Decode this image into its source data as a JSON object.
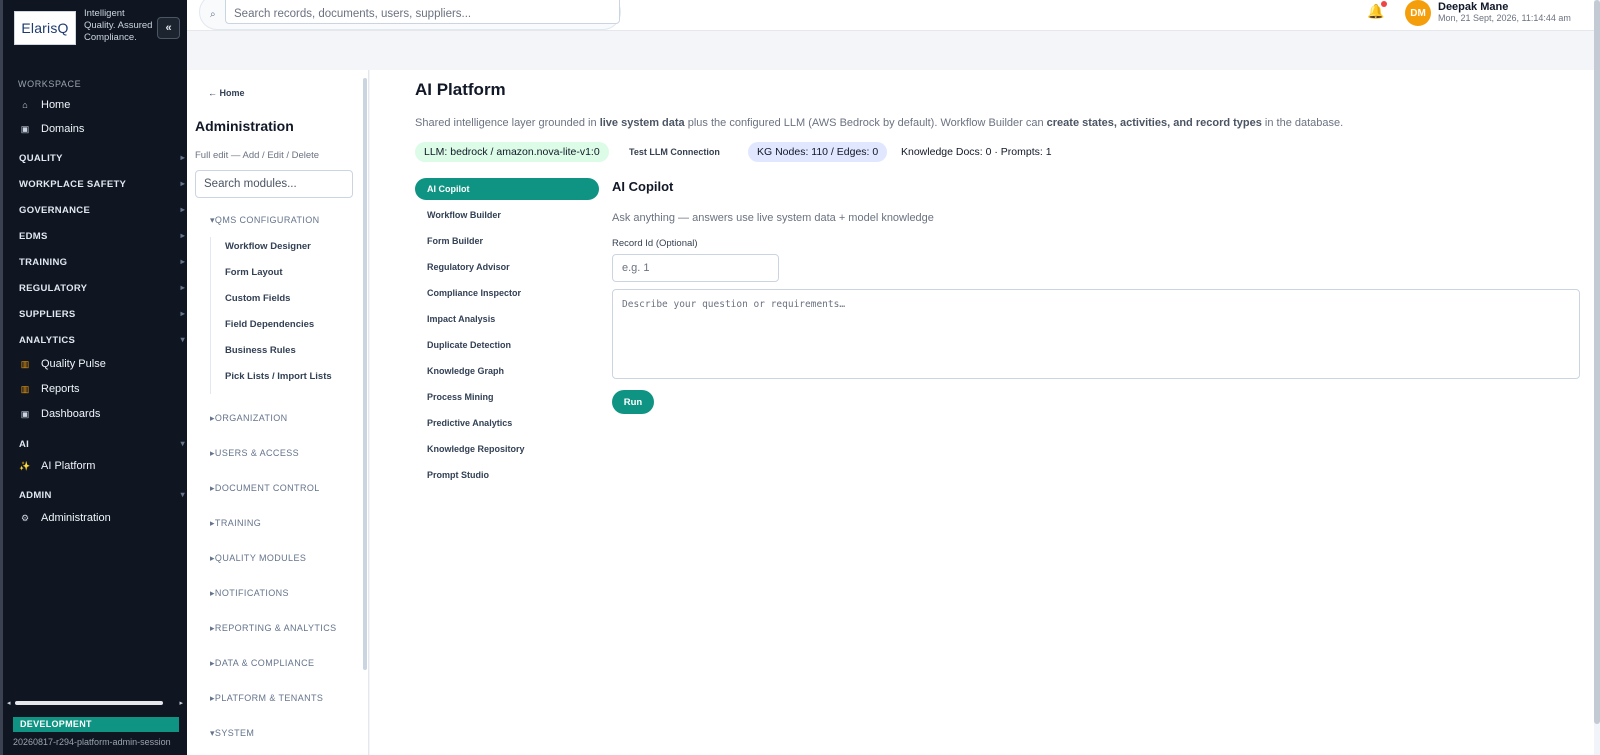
{
  "brand": {
    "logo_text": "ElarisQ",
    "tagline": "Intelligent Quality. Assured Compliance.",
    "collapse_label": "«"
  },
  "sidebar": {
    "workspace_heading": "WORKSPACE",
    "workspace_items": [
      {
        "label": "Home",
        "icon": "home-icon",
        "glyph": "⌂"
      },
      {
        "label": "Domains",
        "icon": "grid-icon",
        "glyph": "▣"
      }
    ],
    "groups": [
      "QUALITY",
      "WORKPLACE SAFETY",
      "GOVERNANCE",
      "EDMS",
      "TRAINING",
      "REGULATORY",
      "SUPPLIERS",
      "ANALYTICS"
    ],
    "analytics_items": [
      {
        "label": "Quality Pulse",
        "icon": "bar-chart-icon",
        "glyph": "▥"
      },
      {
        "label": "Reports",
        "icon": "bar-chart-icon",
        "glyph": "▥"
      },
      {
        "label": "Dashboards",
        "icon": "dashboard-icon",
        "glyph": "▣"
      }
    ],
    "ai_group": "AI",
    "ai_item": {
      "label": "AI Platform",
      "icon": "sparkle-icon",
      "glyph": "✨"
    },
    "admin_group": "ADMIN",
    "admin_item": {
      "label": "Administration",
      "icon": "gear-icon",
      "glyph": "⚙"
    },
    "environment": "DEVELOPMENT",
    "build": "20260817-r294-platform-admin-session"
  },
  "topbar": {
    "search_placeholder": "Search records, documents, users, suppliers...",
    "user_initials": "DM",
    "user_name": "Deepak Mane",
    "datetime": "Mon, 21 Sept, 2026, 11:14:44 am"
  },
  "admin": {
    "breadcrumb": "← Home",
    "title": "Administration",
    "subtitle": "Full edit — Add / Edit / Delete",
    "search_placeholder": "Search modules...",
    "open_section": "▾QMS CONFIGURATION",
    "open_items": [
      "Workflow Designer",
      "Form Layout",
      "Custom Fields",
      "Field Dependencies",
      "Business Rules",
      "Pick Lists / Import Lists"
    ],
    "sections": [
      "▸ORGANIZATION",
      "▸USERS & ACCESS",
      "▸DOCUMENT CONTROL",
      "▸TRAINING",
      "▸QUALITY MODULES",
      "▸NOTIFICATIONS",
      "▸REPORTING & ANALYTICS",
      "▸DATA & COMPLIANCE",
      "▸PLATFORM & TENANTS",
      "▾SYSTEM"
    ]
  },
  "main": {
    "title": "AI Platform",
    "desc_1": "Shared intelligence layer grounded in ",
    "desc_b1": "live system data",
    "desc_2": " plus the configured LLM (AWS Bedrock by default). Workflow Builder can ",
    "desc_b2": "create states, activities, and record types",
    "desc_3": " in the database.",
    "chip_llm": "LLM: bedrock / amazon.nova-lite-v1:0",
    "test_llm": "Test LLM Connection",
    "chip_kg": "KG Nodes: 110 / Edges: 0",
    "knowledge": "Knowledge Docs: 0 · Prompts: 1",
    "tabs": [
      "AI Copilot",
      "Workflow Builder",
      "Form Builder",
      "Regulatory Advisor",
      "Compliance Inspector",
      "Impact Analysis",
      "Duplicate Detection",
      "Knowledge Graph",
      "Process Mining",
      "Predictive Analytics",
      "Knowledge Repository",
      "Prompt Studio"
    ],
    "active_tab": 0,
    "panel_title": "AI Copilot",
    "panel_hint": "Ask anything — answers use live system data + model knowledge",
    "record_label": "Record Id (Optional)",
    "record_placeholder": "e.g. 1",
    "question_placeholder": "Describe your question or requirements…",
    "run_label": "Run"
  },
  "colors": {
    "accent": "#0f9483",
    "sidebar_bg": "#0f1622",
    "avatar": "#f59e0b",
    "alert": "#ef4444"
  }
}
